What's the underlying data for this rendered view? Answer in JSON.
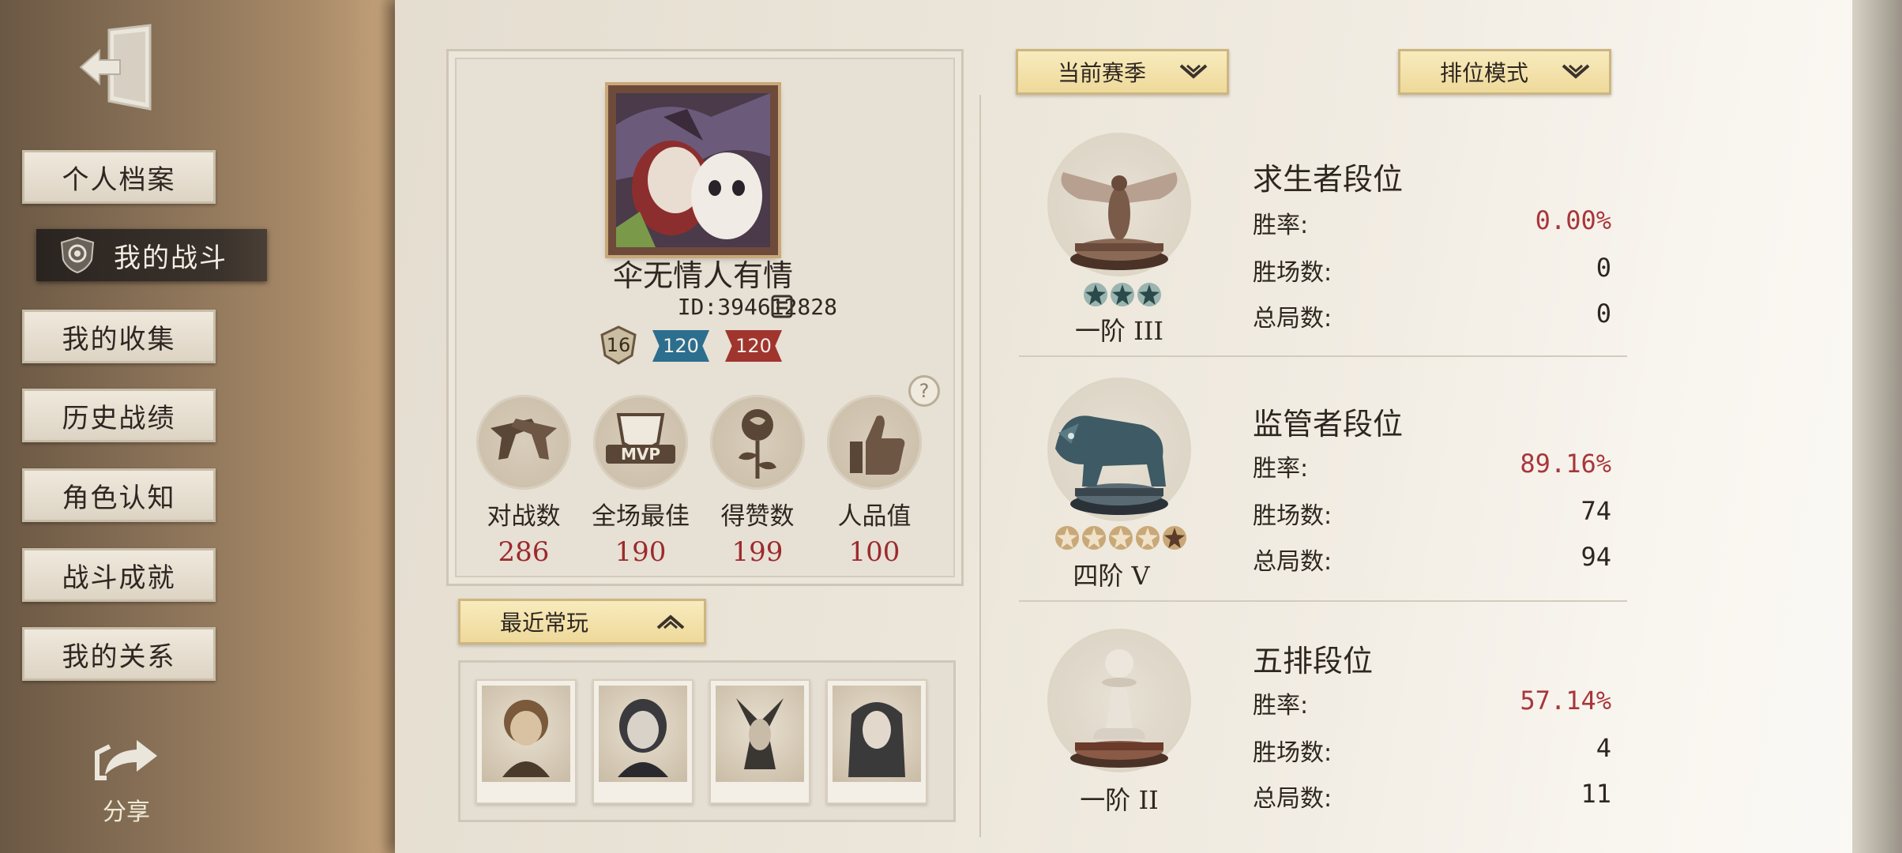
{
  "sidebar": {
    "nav_items": [
      {
        "label": "个人档案"
      },
      {
        "label": "我的战斗"
      },
      {
        "label": "我的收集"
      },
      {
        "label": "历史战绩"
      },
      {
        "label": "角色认知"
      },
      {
        "label": "战斗成就"
      },
      {
        "label": "我的关系"
      }
    ],
    "active_index": 1,
    "share_label": "分享"
  },
  "profile": {
    "name": "伞无情人有情",
    "id": "ID:394612828",
    "level": "16",
    "badges": [
      {
        "value": "120",
        "color": "#2c6e8e"
      },
      {
        "value": "120",
        "color": "#a0352e"
      }
    ],
    "help": "?",
    "stats": [
      {
        "label": "对战数",
        "value": "286",
        "icon": "crossed-guns-icon"
      },
      {
        "label": "全场最佳",
        "value": "190",
        "icon": "mvp-cup-icon"
      },
      {
        "label": "得赞数",
        "value": "199",
        "icon": "rose-icon"
      },
      {
        "label": "人品值",
        "value": "100",
        "icon": "thumbs-up-icon"
      }
    ]
  },
  "recent": {
    "dropdown_label": "最近常玩",
    "characters": [
      "character-1",
      "character-2",
      "character-3",
      "character-4"
    ]
  },
  "filters": {
    "season_label": "当前赛季",
    "mode_label": "排位模式"
  },
  "ranks": [
    {
      "title": "求生者段位",
      "tier_main": "一阶",
      "tier_roman": "III",
      "stars_filled": 3,
      "stars_total": 3,
      "rows": [
        {
          "key": "胜率:",
          "value": "0.00%",
          "red": true
        },
        {
          "key": "胜场数:",
          "value": "0",
          "red": false
        },
        {
          "key": "总局数:",
          "value": "0",
          "red": false
        }
      ]
    },
    {
      "title": "监管者段位",
      "tier_main": "四阶",
      "tier_roman": "V",
      "stars_filled": 1,
      "stars_total": 5,
      "rows": [
        {
          "key": "胜率:",
          "value": "89.16%",
          "red": true
        },
        {
          "key": "胜场数:",
          "value": "74",
          "red": false
        },
        {
          "key": "总局数:",
          "value": "94",
          "red": false
        }
      ]
    },
    {
      "title": "五排段位",
      "tier_main": "一阶",
      "tier_roman": "II",
      "rows": [
        {
          "key": "胜率:",
          "value": "57.14%",
          "red": true
        },
        {
          "key": "胜场数:",
          "value": "4",
          "red": false
        },
        {
          "key": "总局数:",
          "value": "11",
          "red": false
        }
      ]
    }
  ],
  "colors": {
    "accent_red": "#a8363a",
    "dropdown_gold": "#eed99a",
    "sidebar_brown": "#8a7258"
  }
}
